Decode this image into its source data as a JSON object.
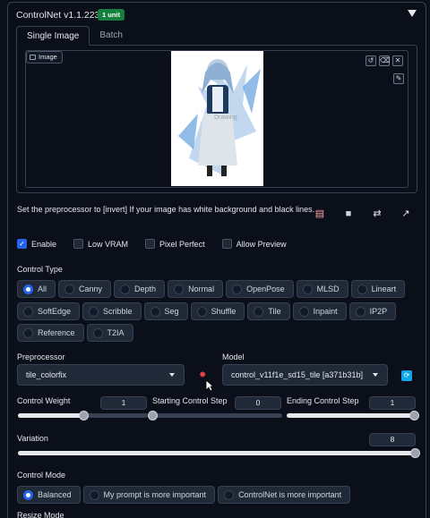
{
  "header": {
    "title": "ControlNet v1.1.223",
    "badge": "1 unit"
  },
  "tabs": [
    {
      "label": "Single Image",
      "active": true
    },
    {
      "label": "Batch",
      "active": false
    }
  ],
  "image_panel": {
    "label": "Image",
    "watermark_text": "Drawing"
  },
  "note": "Set the preprocessor to [invert] If your image has white background and black lines.",
  "checkboxes": [
    {
      "label": "Enable",
      "checked": true
    },
    {
      "label": "Low VRAM",
      "checked": false
    },
    {
      "label": "Pixel Perfect",
      "checked": false
    },
    {
      "label": "Allow Preview",
      "checked": false
    }
  ],
  "control_type": {
    "label": "Control Type",
    "row1": [
      "All",
      "Canny",
      "Depth",
      "Normal",
      "OpenPose",
      "MLSD",
      "Lineart"
    ],
    "row2": [
      "SoftEdge",
      "Scribble",
      "Seg",
      "Shuffle",
      "Tile",
      "Inpaint",
      "IP2P"
    ],
    "row3": [
      "Reference",
      "T2IA"
    ],
    "selected": "All"
  },
  "preprocessor": {
    "label": "Preprocessor",
    "value": "tile_colorfix"
  },
  "model": {
    "label": "Model",
    "value": "control_v11f1e_sd15_tile [a371b31b]"
  },
  "control_weight": {
    "label": "Control Weight",
    "value": "1",
    "fraction": 0.5
  },
  "starting_step": {
    "label": "Starting Control Step",
    "value": "0",
    "fraction": 0.0
  },
  "ending_step": {
    "label": "Ending Control Step",
    "value": "1",
    "fraction": 1.0
  },
  "variation": {
    "label": "Variation",
    "value": "8",
    "fraction": 1.0
  },
  "control_mode": {
    "label": "Control Mode",
    "options": [
      "Balanced",
      "My prompt is more important",
      "ControlNet is more important"
    ],
    "selected": "Balanced"
  },
  "resize_mode": {
    "label": "Resize Mode"
  }
}
